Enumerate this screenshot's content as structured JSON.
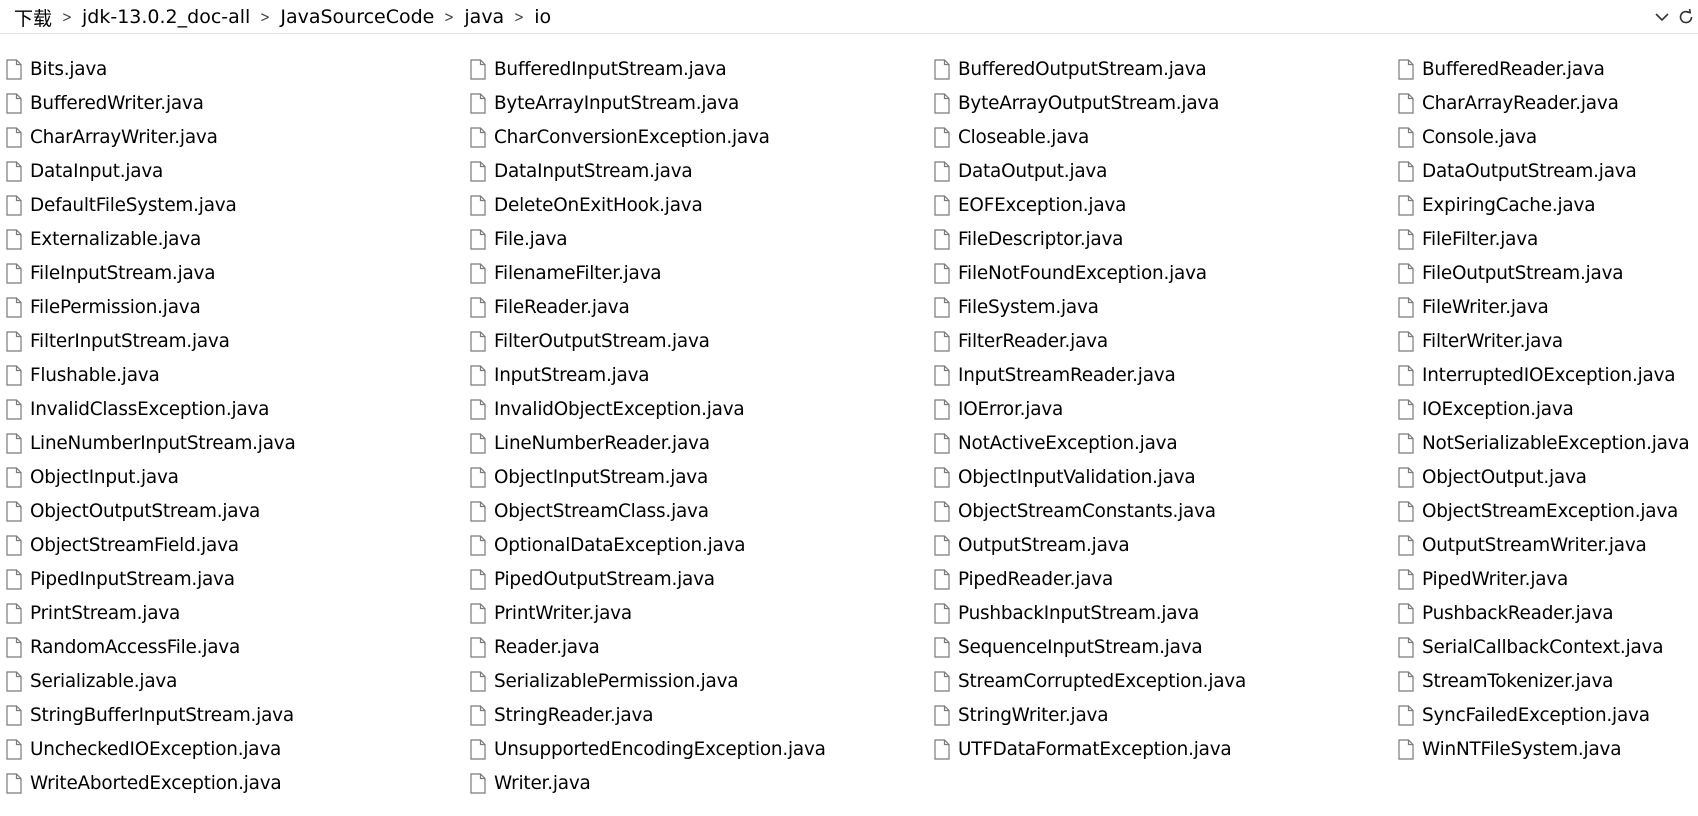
{
  "breadcrumb": [
    "下载",
    "jdk-13.0.2_doc-all",
    "JavaSourceCode",
    "java",
    "io"
  ],
  "icons": {
    "separator": "chevron-right-icon",
    "dropdown": "chevron-down-icon",
    "refresh": "refresh-icon",
    "file": "blank-file-icon"
  },
  "colors": {
    "text": "#000000",
    "file_icon_stroke": "#7a7a7a",
    "divider": "#e5e5e5"
  },
  "files": [
    "Bits.java",
    "BufferedInputStream.java",
    "BufferedOutputStream.java",
    "BufferedReader.java",
    "BufferedWriter.java",
    "ByteArrayInputStream.java",
    "ByteArrayOutputStream.java",
    "CharArrayReader.java",
    "CharArrayWriter.java",
    "CharConversionException.java",
    "Closeable.java",
    "Console.java",
    "DataInput.java",
    "DataInputStream.java",
    "DataOutput.java",
    "DataOutputStream.java",
    "DefaultFileSystem.java",
    "DeleteOnExitHook.java",
    "EOFException.java",
    "ExpiringCache.java",
    "Externalizable.java",
    "File.java",
    "FileDescriptor.java",
    "FileFilter.java",
    "FileInputStream.java",
    "FilenameFilter.java",
    "FileNotFoundException.java",
    "FileOutputStream.java",
    "FilePermission.java",
    "FileReader.java",
    "FileSystem.java",
    "FileWriter.java",
    "FilterInputStream.java",
    "FilterOutputStream.java",
    "FilterReader.java",
    "FilterWriter.java",
    "Flushable.java",
    "InputStream.java",
    "InputStreamReader.java",
    "InterruptedIOException.java",
    "InvalidClassException.java",
    "InvalidObjectException.java",
    "IOError.java",
    "IOException.java",
    "LineNumberInputStream.java",
    "LineNumberReader.java",
    "NotActiveException.java",
    "NotSerializableException.java",
    "ObjectInput.java",
    "ObjectInputStream.java",
    "ObjectInputValidation.java",
    "ObjectOutput.java",
    "ObjectOutputStream.java",
    "ObjectStreamClass.java",
    "ObjectStreamConstants.java",
    "ObjectStreamException.java",
    "ObjectStreamField.java",
    "OptionalDataException.java",
    "OutputStream.java",
    "OutputStreamWriter.java",
    "PipedInputStream.java",
    "PipedOutputStream.java",
    "PipedReader.java",
    "PipedWriter.java",
    "PrintStream.java",
    "PrintWriter.java",
    "PushbackInputStream.java",
    "PushbackReader.java",
    "RandomAccessFile.java",
    "Reader.java",
    "SequenceInputStream.java",
    "SerialCallbackContext.java",
    "Serializable.java",
    "SerializablePermission.java",
    "StreamCorruptedException.java",
    "StreamTokenizer.java",
    "StringBufferInputStream.java",
    "StringReader.java",
    "StringWriter.java",
    "SyncFailedException.java",
    "UncheckedIOException.java",
    "UnsupportedEncodingException.java",
    "UTFDataFormatException.java",
    "WinNTFileSystem.java",
    "WriteAbortedException.java",
    "Writer.java"
  ]
}
